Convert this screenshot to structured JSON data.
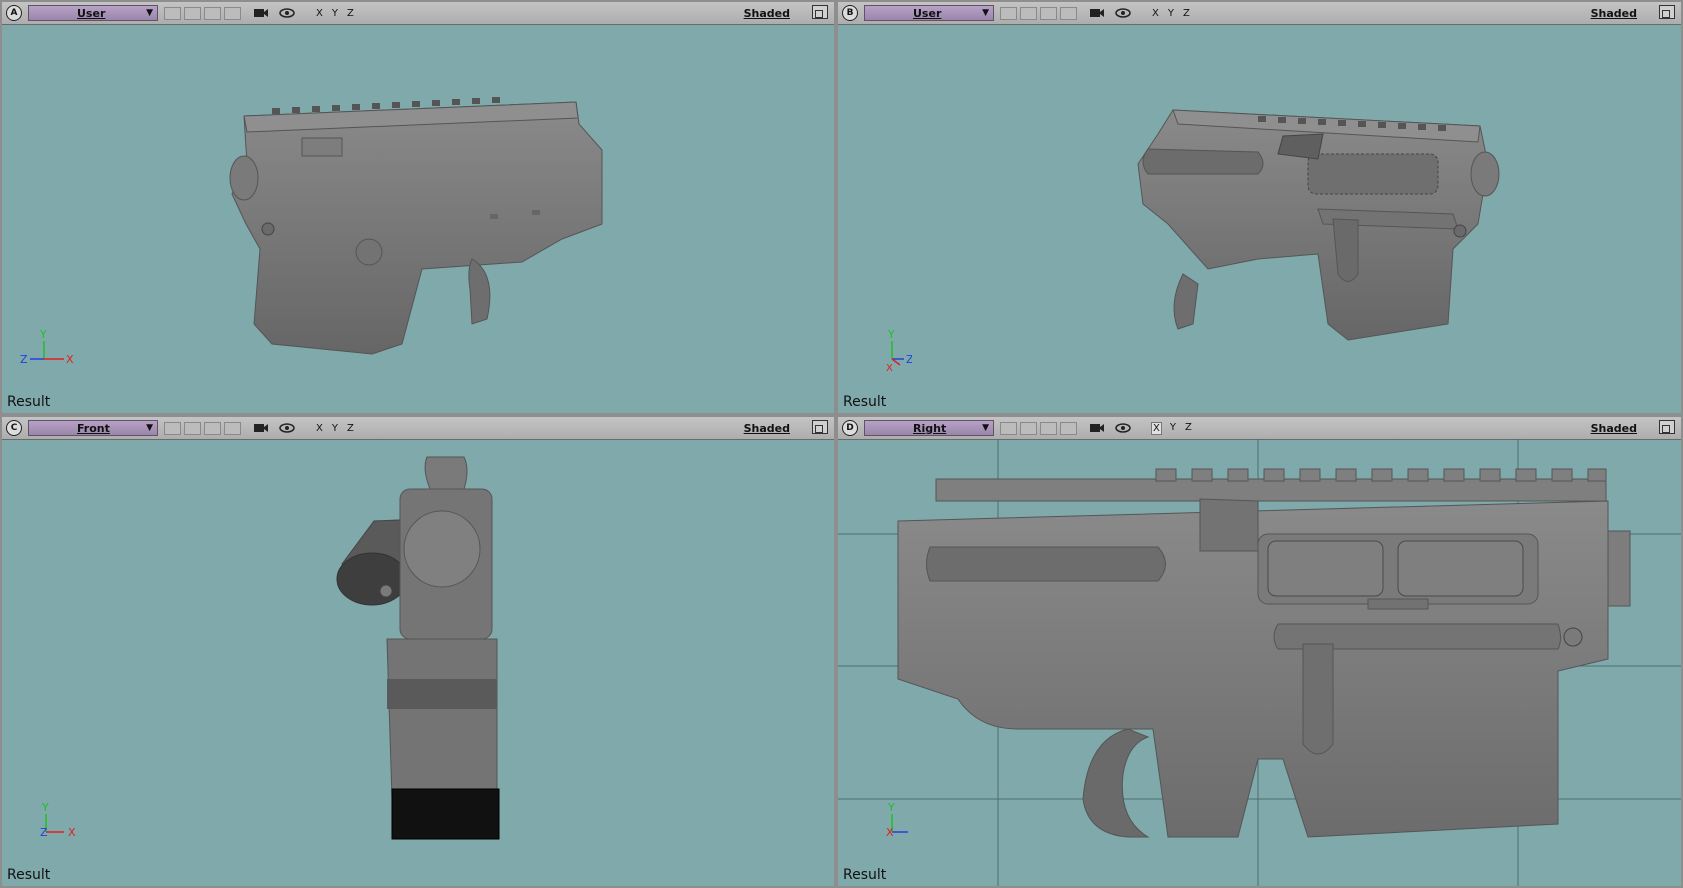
{
  "viewports": [
    {
      "id": "A",
      "letter": "A",
      "camera": "User",
      "shading": "Shaded",
      "result": "Result",
      "axes": [
        "X",
        "Y",
        "Z"
      ],
      "triad": {
        "h": "Z",
        "h2": "X",
        "v": "Y"
      }
    },
    {
      "id": "B",
      "letter": "B",
      "camera": "User",
      "shading": "Shaded",
      "result": "Result",
      "axes": [
        "X",
        "Y",
        "Z"
      ],
      "triad": {
        "h": "X",
        "h2": "Z",
        "v": "Y"
      }
    },
    {
      "id": "C",
      "letter": "C",
      "camera": "Front",
      "shading": "Shaded",
      "result": "Result",
      "axes": [
        "X",
        "Y",
        "Z"
      ],
      "triad": {
        "h": "Z",
        "h2": "X",
        "v": "Y"
      }
    },
    {
      "id": "D",
      "letter": "D",
      "camera": "Right",
      "shading": "Shaded",
      "result": "Result",
      "axes": [
        "X",
        "Y",
        "Z"
      ],
      "active_axis": "X",
      "triad": {
        "h": "X",
        "h2": "Z",
        "v": "Y"
      }
    }
  ],
  "colors": {
    "viewport_bg": "#7fa9ab",
    "model": "#777777",
    "camera_menu": "#a793b8",
    "axis_x": "#e02020",
    "axis_y": "#20c020",
    "axis_z": "#2040e0"
  }
}
